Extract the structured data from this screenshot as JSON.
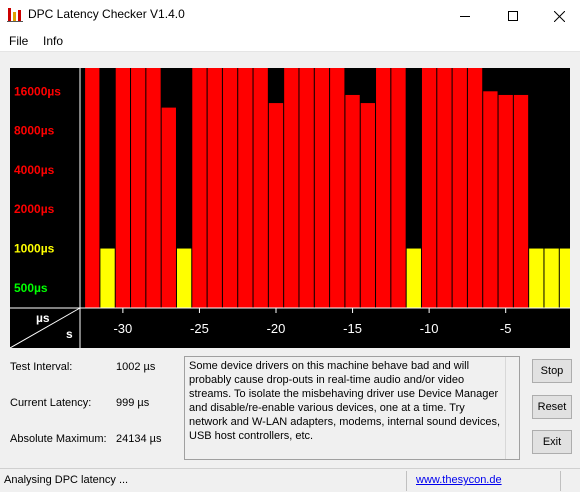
{
  "window": {
    "title": "DPC Latency Checker V1.4.0",
    "minimize": "—",
    "maximize": "☐",
    "close": "✕"
  },
  "menu": {
    "file": "File",
    "info": "Info"
  },
  "chart_data": {
    "type": "bar",
    "y_tick_labels": [
      {
        "label": "16000µs",
        "value": 16000,
        "color": "#ff0000"
      },
      {
        "label": "8000µs",
        "value": 8000,
        "color": "#ff0000"
      },
      {
        "label": "4000µs",
        "value": 4000,
        "color": "#ff0000"
      },
      {
        "label": "2000µs",
        "value": 2000,
        "color": "#ff0000"
      },
      {
        "label": "1000µs",
        "value": 1000,
        "color": "#ffff00"
      },
      {
        "label": "500µs",
        "value": 500,
        "color": "#00ff00"
      }
    ],
    "y_unit_label": "µs",
    "x_unit_label": "s",
    "x_tick_labels": [
      "-30",
      "-25",
      "-20",
      "-15",
      "-10",
      "-5"
    ],
    "x_ticks": [
      -30,
      -25,
      -20,
      -15,
      -10,
      -5
    ],
    "x_range": [
      -32.8,
      -0.8
    ],
    "y_scale": "log",
    "ylim": [
      350,
      24134
    ],
    "bar_x": [
      -32,
      -31,
      -30,
      -29,
      -28,
      -27,
      -26,
      -25,
      -24,
      -23,
      -22,
      -21,
      -20,
      -19,
      -18,
      -17,
      -16,
      -15,
      -14,
      -13,
      -12,
      -11,
      -10,
      -9,
      -8,
      -7,
      -6,
      -5,
      -4,
      -3,
      -2,
      -1
    ],
    "values": [
      24134,
      999,
      24134,
      24134,
      24134,
      12000,
      999,
      24134,
      24134,
      24134,
      24134,
      24134,
      13000,
      24134,
      24134,
      24134,
      24134,
      15000,
      13000,
      24134,
      24134,
      999,
      24134,
      24134,
      24134,
      24134,
      16000,
      15000,
      15000,
      999,
      999,
      999
    ],
    "colors": {
      "red": "#ff0000",
      "yellow": "#ffff00",
      "background": "#000000",
      "axis": "#ffffff"
    }
  },
  "stats": {
    "test_interval_label": "Test Interval:",
    "test_interval_value": "1002 µs",
    "current_latency_label": "Current Latency:",
    "current_latency_value": "999 µs",
    "absolute_max_label": "Absolute Maximum:",
    "absolute_max_value": "24134 µs"
  },
  "info_text": "Some device drivers on this machine behave bad and will probably cause drop-outs in real-time audio and/or video streams. To isolate the misbehaving driver use Device Manager and disable/re-enable various devices, one at a time. Try network and W-LAN adapters, modems, internal sound devices, USB host controllers, etc.",
  "buttons": {
    "stop": "Stop",
    "reset": "Reset",
    "exit": "Exit"
  },
  "status": {
    "text": "Analysing DPC latency ...",
    "link": "www.thesycon.de"
  }
}
